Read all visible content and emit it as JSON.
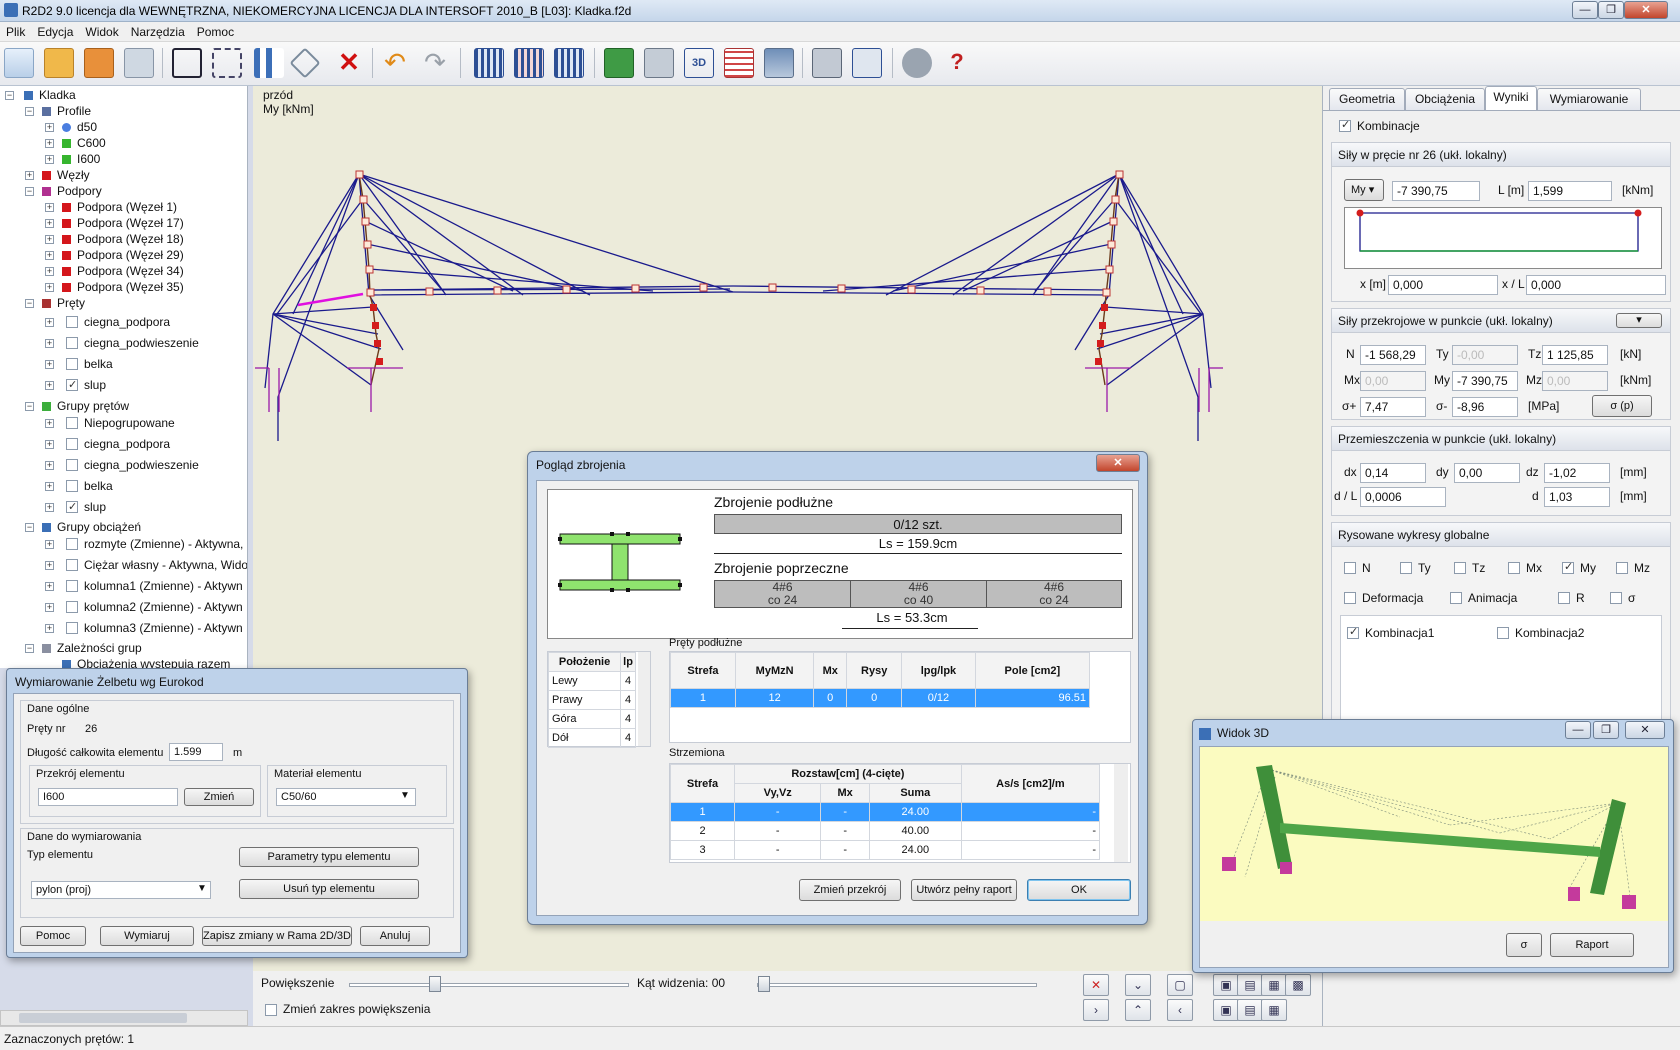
{
  "window": {
    "title": "R2D2 9.0 licencja dla WEWNĘTRZNA, NIEKOMERCYJNA LICENCJA DLA INTERSOFT 2010_B [L03]: Kladka.f2d",
    "min": "—",
    "max": "❐",
    "close": "✕"
  },
  "menu": [
    "Plik",
    "Edycja",
    "Widok",
    "Narzędzia",
    "Pomoc"
  ],
  "toolbar": {
    "icons": [
      "new-file",
      "open-folder",
      "save",
      "save-as",
      "nodes",
      "copy-elements",
      "loads",
      "trim",
      "delete",
      "undo",
      "redo",
      "table-1",
      "table-2",
      "table-3",
      "calc-frame",
      "view-2d",
      "view-3d",
      "grid",
      "align",
      "calculator",
      "report",
      "settings",
      "help"
    ]
  },
  "tree": {
    "root": "Kladka",
    "profile": "Profile",
    "profiles": [
      "d50",
      "C600",
      "I600"
    ],
    "nodes": "Węzły",
    "supports": "Podpory",
    "support_items": [
      "Podpora (Węzeł 1)",
      "Podpora (Węzeł 17)",
      "Podpora (Węzeł 18)",
      "Podpora (Węzeł 29)",
      "Podpora (Węzeł 34)",
      "Podpora (Węzeł 35)"
    ],
    "bars": "Pręty",
    "bar_items": [
      "ciegna_podpora",
      "ciegna_podwieszenie",
      "belka",
      "slup"
    ],
    "groups": "Grupy prętów",
    "group_items": [
      "Niepogrupowane",
      "ciegna_podpora",
      "ciegna_podwieszenie",
      "belka",
      "slup"
    ],
    "load_groups": "Grupy obciążeń",
    "load_items": [
      "rozmyte (Zmienne) - Aktywna,",
      "Ciężar własny - Aktywna, Wido",
      "kolumna1 (Zmienne) - Aktywn",
      "kolumna2 (Zmienne) - Aktywn",
      "kolumna3 (Zmienne) - Aktywn"
    ],
    "deps": "Zależności grup",
    "dep_item": "Obciążenia występują razem"
  },
  "canvas": {
    "view": "przód",
    "quantity": "My [kNm]"
  },
  "rpanel": {
    "tabs": [
      "Geometria",
      "Obciążenia",
      "Wyniki",
      "Wymiarowanie"
    ],
    "kombinacje": "Kombinacje",
    "forces_title": "Siły w pręcie nr 26 (ukł. lokalny)",
    "my_sel": "My",
    "my_val": "-7 390,75",
    "L_label": "L [m]",
    "L_val": "1,599",
    "unit_knm": "[kNm]",
    "x_label": "x [m]",
    "x_val": "0,000",
    "xl_label": "x / L",
    "xl_val": "0,000",
    "section_title": "Siły przekrojowe w punkcie (ukł. lokalny)",
    "N": "N",
    "N_val": "-1 568,29",
    "Ty": "Ty",
    "Ty_val": "-0,00",
    "Tz": "Tz",
    "Tz_val": "1 125,85",
    "unit_kn": "[kN]",
    "Mx": "Mx",
    "Mx_val": "0,00",
    "My": "My",
    "My_val": "-7 390,75",
    "Mz": "Mz",
    "Mz_val": "0,00",
    "unit_knm2": "[kNm]",
    "sp": "σ+",
    "sp_val": "7,47",
    "sm": "σ-",
    "sm_val": "-8,96",
    "unit_mpa": "[MPa]",
    "sigma_btn": "σ (p)",
    "disp_title": "Przemieszczenia w punkcie (ukł. lokalny)",
    "dx": "dx",
    "dx_val": "0,14",
    "dy": "dy",
    "dy_val": "0,00",
    "dz": "dz",
    "dz_val": "-1,02",
    "unit_mm": "[mm]",
    "dl": "d / L",
    "dl_val": "0,0006",
    "d": "d",
    "d_val": "1,03",
    "unit_mm2": "[mm]",
    "global_title": "Rysowane wykresy globalne",
    "checks": [
      "N",
      "Ty",
      "Tz",
      "Mx",
      "My",
      "Mz"
    ],
    "deform": "Deformacja",
    "anim": "Animacja",
    "r": "R",
    "sig": "σ",
    "komb1": "Kombinacja1",
    "komb2": "Kombinacja2"
  },
  "dialog_zb": {
    "title": "Pogląd zbrojenia",
    "long_title": "Zbrojenie podłużne",
    "long_val": "0/12 szt.",
    "ls1": "Ls = 159.9cm",
    "trans_title": "Zbrojenie poprzeczne",
    "trans": [
      "4#6",
      "4#6",
      "4#6"
    ],
    "trans_co": [
      "co 24",
      "co 40",
      "co 24"
    ],
    "ls2": "Ls = 53.3cm",
    "pos_head": [
      "Położenie",
      "lp"
    ],
    "pos_rows": [
      [
        "Lewy",
        "4"
      ],
      [
        "Prawy",
        "4"
      ],
      [
        "Góra",
        "4"
      ],
      [
        "Dół",
        "4"
      ]
    ],
    "long_tbl_title": "Pręty podłużne",
    "long_head": [
      "Strefa",
      "MyMzN",
      "Mx",
      "Rysy",
      "lpg/lpk",
      "Pole [cm2]"
    ],
    "long_row": [
      "1",
      "12",
      "0",
      "0",
      "0/12",
      "96.51"
    ],
    "str_title": "Strzemiona",
    "str_head": [
      "Strefa",
      "Rozstaw[cm] (4-cięte)",
      "As/s [cm2]/m"
    ],
    "str_sub": [
      "Vy,Vz",
      "Mx",
      "Suma"
    ],
    "str_rows": [
      [
        "1",
        "-",
        "-",
        "24.00",
        "-"
      ],
      [
        "2",
        "-",
        "-",
        "40.00",
        "-"
      ],
      [
        "3",
        "-",
        "-",
        "24.00",
        "-"
      ]
    ],
    "btn_change": "Zmień przekrój",
    "btn_report": "Utwórz pełny raport",
    "btn_ok": "OK"
  },
  "dialog_wym": {
    "title": "Wymiarowanie Żelbetu wg Eurokod",
    "general": "Dane ogólne",
    "bar_nr": "Pręty nr",
    "bar_nr_val": "26",
    "len_label": "Długość całkowita elementu",
    "len_val": "1.599",
    "len_unit": "m",
    "section": "Przekrój elementu",
    "section_val": "I600",
    "change": "Zmień",
    "material": "Materiał elementu",
    "material_val": "C50/60",
    "dim_data": "Dane do wymiarowania",
    "type_label": "Typ elementu",
    "type_val": "pylon (proj)",
    "param_btn": "Parametry typu elementu",
    "del_btn": "Usuń typ elementu",
    "help": "Pomoc",
    "dimension": "Wymiaruj",
    "save": "Zapisz zmiany w Rama 2D/3D",
    "cancel": "Anuluj"
  },
  "view3d": {
    "title": "Widok 3D",
    "sigma": "σ",
    "report": "Raport"
  },
  "bottom": {
    "zoom": "Powiększenie",
    "angle": "Kąt widzenia: 00",
    "zoom_range": "Zmień zakres powiększenia"
  },
  "status": "Zaznaczonych prętów: 1"
}
